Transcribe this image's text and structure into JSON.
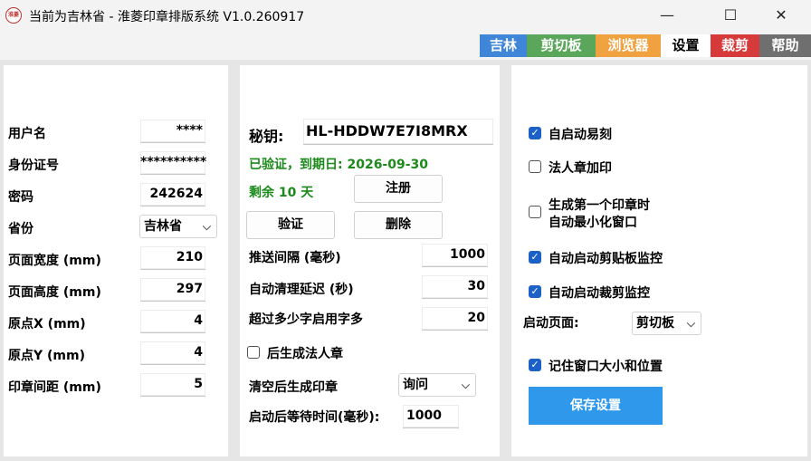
{
  "window": {
    "title": "当前为吉林省 - 淮菱印章排版系统 V1.0.260917",
    "icon_text": "淮菱",
    "minimize_glyph": "—",
    "maximize_glyph": "☐",
    "close_glyph": "✕"
  },
  "tabs": [
    {
      "label": "吉林",
      "color": "#3f86d8"
    },
    {
      "label": "剪切板",
      "color": "#5aa65a"
    },
    {
      "label": "浏览器",
      "color": "#f0a241"
    },
    {
      "label": "设置",
      "color": "#ffffff",
      "active": true
    },
    {
      "label": "裁剪",
      "color": "#d63a3a"
    },
    {
      "label": "帮助",
      "color": "#6f6f6f"
    }
  ],
  "account": {
    "username_label": "用户名",
    "username_value": "****",
    "id_label": "身份证号",
    "id_value": "**********",
    "password_label": "密码",
    "password_value": "242624",
    "province_label": "省份",
    "province_value": "吉林省",
    "page_width_label": "页面宽度 (mm)",
    "page_width_value": "210",
    "page_height_label": "页面高度 (mm)",
    "page_height_value": "297",
    "origin_x_label": "原点X (mm)",
    "origin_x_value": "4",
    "origin_y_label": "原点Y (mm)",
    "origin_y_value": "4",
    "stamp_spacing_label": "印章间距 (mm)",
    "stamp_spacing_value": "5"
  },
  "license": {
    "key_label": "秘钥:",
    "key_value": "HL-HDDW7E7I8MRX",
    "status_text": "已验证，到期日: 2026-09-30",
    "remaining_text": "剩余 10 天",
    "register_button": "注册",
    "verify_button": "验证",
    "delete_button": "删除",
    "push_interval_label": "推送间隔 (毫秒)",
    "push_interval_value": "1000",
    "auto_clear_label": "自动清理延迟 (秒)",
    "auto_clear_value": "30",
    "char_limit_label": "超过多少字启用字多",
    "char_limit_value": "20",
    "legal_after_label": "后生成法人章",
    "legal_after_checked": false,
    "clear_then_label": "清空后生成印章",
    "clear_then_value": "询问",
    "startup_wait_label": "启动后等待时间(毫秒):",
    "startup_wait_value": "1000"
  },
  "options": {
    "auto_start_label": "自启动易刻",
    "auto_start_checked": true,
    "legal_stamp_label": "法人章加印",
    "legal_stamp_checked": false,
    "minimize_line1": "生成第一个印章时",
    "minimize_line2": "自动最小化窗口",
    "minimize_checked": false,
    "clipboard_monitor_label": "自动启动剪贴板监控",
    "clipboard_monitor_checked": true,
    "crop_monitor_label": "自动启动裁剪监控",
    "crop_monitor_checked": true,
    "startup_page_label": "启动页面:",
    "startup_page_value": "剪切板",
    "remember_window_label": "记住窗口大小和位置",
    "remember_window_checked": true,
    "save_button": "保存设置",
    "save_button_color": "#2f98ea"
  }
}
